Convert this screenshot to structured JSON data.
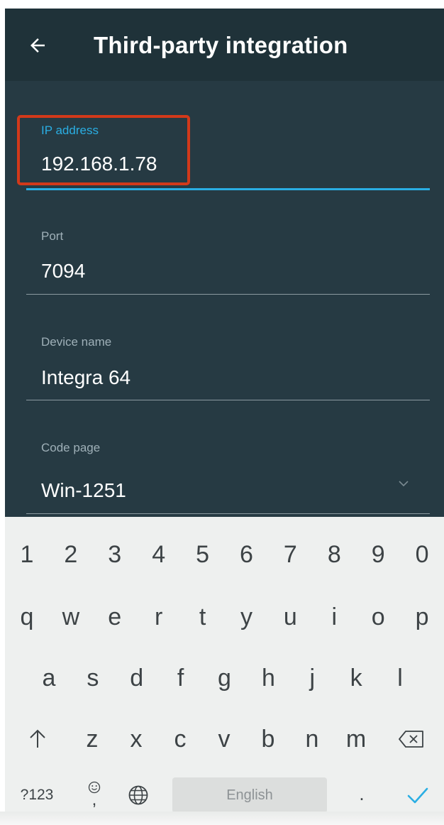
{
  "appbar": {
    "title": "Third-party integration"
  },
  "form": {
    "ip": {
      "label": "IP address",
      "value": "192.168.1.78"
    },
    "port": {
      "label": "Port",
      "value": "7094"
    },
    "device": {
      "label": "Device name",
      "value": "Integra 64"
    },
    "codepage": {
      "label": "Code page",
      "value": "Win-1251"
    }
  },
  "keyboard": {
    "numbers": [
      "1",
      "2",
      "3",
      "4",
      "5",
      "6",
      "7",
      "8",
      "9",
      "0"
    ],
    "row_qwerty": [
      "q",
      "w",
      "e",
      "r",
      "t",
      "y",
      "u",
      "i",
      "o",
      "p"
    ],
    "row_asdf": [
      "a",
      "s",
      "d",
      "f",
      "g",
      "h",
      "j",
      "k",
      "l"
    ],
    "row_zxcv": [
      "z",
      "x",
      "c",
      "v",
      "b",
      "n",
      "m"
    ],
    "symbols_key": "?123",
    "comma_key": ",",
    "space_label": "English",
    "period_key": "."
  },
  "colors": {
    "accent": "#2aaee3",
    "highlight": "#d2391a",
    "background": "#263a43",
    "appbar": "#1f3239"
  }
}
